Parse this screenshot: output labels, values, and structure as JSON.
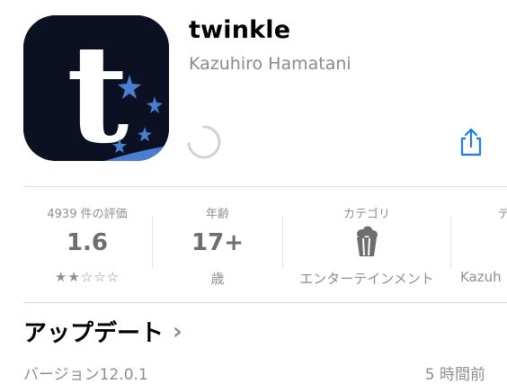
{
  "app": {
    "name": "twinkle",
    "developer": "Kazuhiro Hamatani",
    "icon_letter": "t",
    "icon_background": "#0b1022",
    "icon_accent": "#4a7fd0"
  },
  "accent_color": "#1a7cf5",
  "info": {
    "ratings": {
      "label": "4939 件の評価",
      "value": "1.6",
      "stars": "★★☆☆☆",
      "rating_fraction": 0.32
    },
    "age": {
      "label": "年齢",
      "value": "17+",
      "sub": "歳"
    },
    "category": {
      "label": "カテゴリ",
      "icon": "popcorn-icon",
      "sub": "エンターテインメント"
    },
    "developer": {
      "label": "デ",
      "sub": "Kazuh"
    }
  },
  "updates": {
    "heading": "アップデート",
    "chevron": "›",
    "version": "バージョン12.0.1",
    "time": "5 時間前"
  }
}
